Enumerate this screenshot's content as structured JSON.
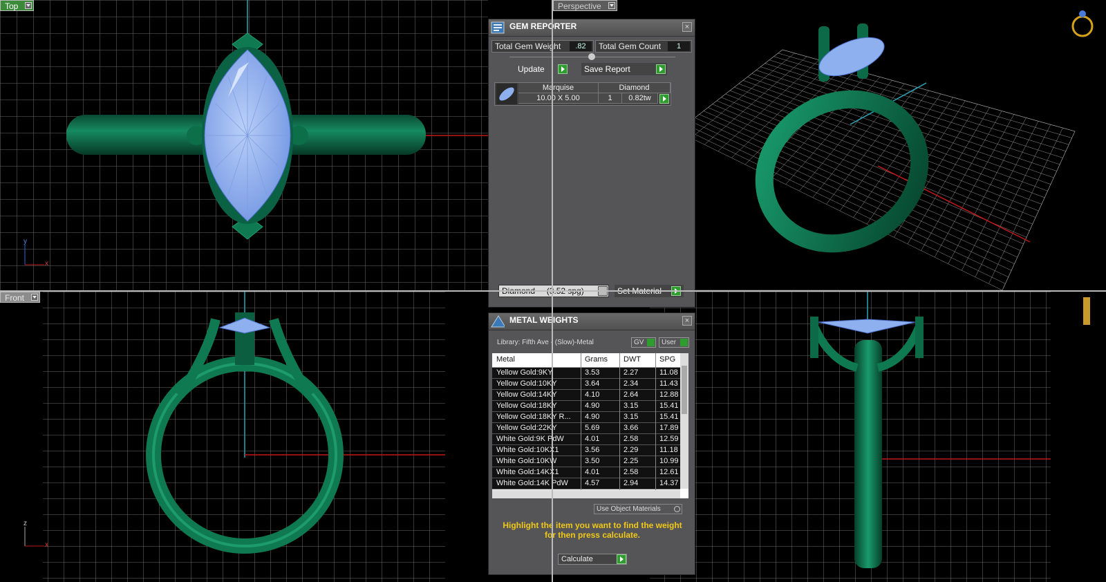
{
  "viewports": {
    "top": {
      "label": "Top",
      "axes": [
        "y",
        "x"
      ]
    },
    "perspective": {
      "label": "Perspective"
    },
    "front": {
      "label": "Front",
      "axes": [
        "z",
        "x"
      ]
    }
  },
  "gem_reporter": {
    "title": "GEM REPORTER",
    "total_gem_weight_label": "Total Gem Weight",
    "total_gem_weight": ".82",
    "total_gem_count_label": "Total Gem Count",
    "total_gem_count": "1",
    "update_label": "Update",
    "save_report_label": "Save Report",
    "gem": {
      "shape": "Marquise",
      "type": "Diamond",
      "size": "10.00 X 5.00",
      "count": "1",
      "weight": "0.82tw"
    },
    "material_select": "Diamond     (3.52 spg)",
    "set_material_label": "Set Material"
  },
  "metal_weights": {
    "title": "METAL WEIGHTS",
    "library": "Library: Fifth Ave - (Slow)-Metal",
    "gv_label": "GV",
    "user_label": "User",
    "columns": [
      "Metal",
      "Grams",
      "DWT",
      "SPG"
    ],
    "rows": [
      [
        "Yellow Gold:9KY",
        "3.53",
        "2.27",
        "11.08"
      ],
      [
        "Yellow Gold:10KY",
        "3.64",
        "2.34",
        "11.43"
      ],
      [
        "Yellow Gold:14KY",
        "4.10",
        "2.64",
        "12.88"
      ],
      [
        "Yellow Gold:18KY",
        "4.90",
        "3.15",
        "15.41"
      ],
      [
        "Yellow Gold:18KY R...",
        "4.90",
        "3.15",
        "15.41"
      ],
      [
        "Yellow Gold:22KY",
        "5.69",
        "3.66",
        "17.89"
      ],
      [
        "White Gold:9K PdW",
        "4.01",
        "2.58",
        "12.59"
      ],
      [
        "White Gold:10KX1",
        "3.56",
        "2.29",
        "11.18"
      ],
      [
        "White Gold:10KW",
        "3.50",
        "2.25",
        "10.99"
      ],
      [
        "White Gold:14KX1",
        "4.01",
        "2.58",
        "12.61"
      ],
      [
        "White Gold:14K PdW",
        "4.57",
        "2.94",
        "14.37"
      ]
    ],
    "use_object_materials": "Use Object Materials",
    "hint": "Highlight the item you want to find the weight for then press calculate.",
    "calculate_label": "Calculate"
  },
  "colors": {
    "ring": "#0f6b4a",
    "gem": "#8fb0ee",
    "grid": "#9a9a9a",
    "accent": "#e8c21a"
  }
}
